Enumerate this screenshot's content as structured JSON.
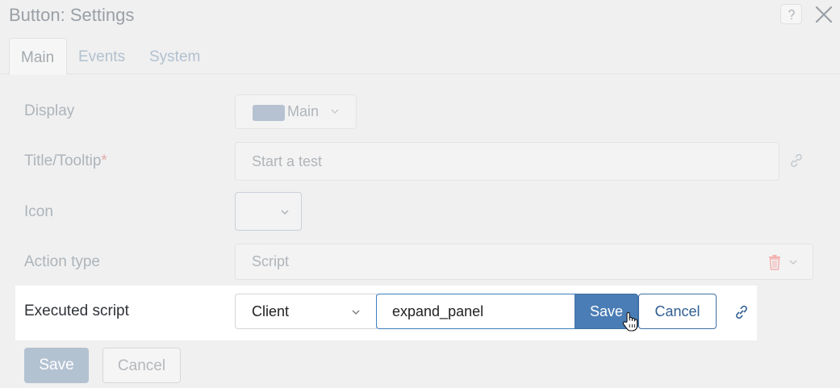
{
  "window": {
    "title": "Button: Settings"
  },
  "tabs": [
    {
      "label": "Main",
      "active": true
    },
    {
      "label": "Events",
      "active": false
    },
    {
      "label": "System",
      "active": false
    }
  ],
  "form": {
    "display": {
      "label": "Display",
      "value": "Main"
    },
    "title_tooltip": {
      "label": "Title/Tooltip",
      "required_mark": "*",
      "value": "Start a test"
    },
    "icon": {
      "label": "Icon"
    },
    "action_type": {
      "label": "Action type",
      "value": "Script"
    },
    "executed_script": {
      "label": "Executed script",
      "mode": "Client",
      "script_name": "expand_panel",
      "save_label": "Save",
      "cancel_label": "Cancel"
    }
  },
  "footer": {
    "save_label": "Save",
    "cancel_label": "Cancel"
  },
  "colors": {
    "accent": "#4a7db5",
    "disabled_button": "#b3c2d1",
    "swatch": "#b6c2d1",
    "delete_icon": "#f3b1b1",
    "link_icon": "#2f5f93"
  }
}
